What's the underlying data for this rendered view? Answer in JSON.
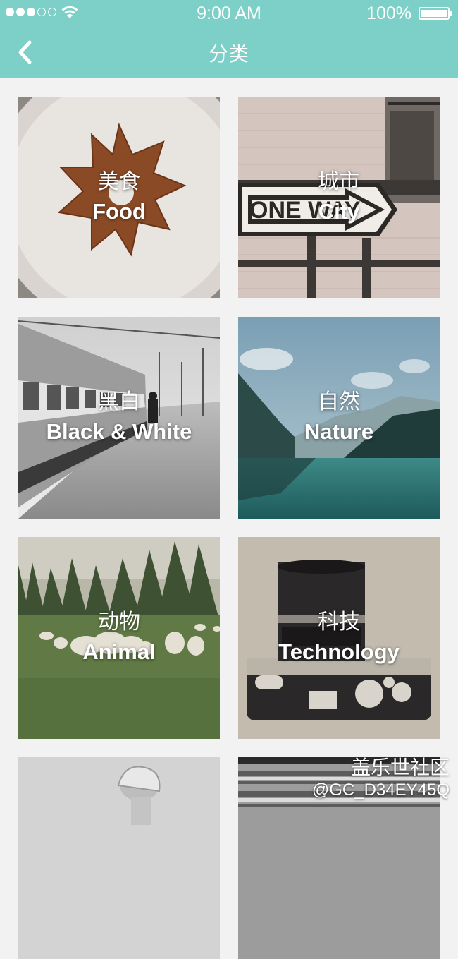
{
  "status_bar": {
    "time": "9:00 AM",
    "battery": "100%",
    "signal_bars": 3,
    "signal_total": 5
  },
  "nav": {
    "title": "分类",
    "back_icon": "chevron-left-icon"
  },
  "categories": [
    {
      "zh": "美食",
      "en": "Food"
    },
    {
      "zh": "城市",
      "en": "City",
      "sign_text": "ONE WAY"
    },
    {
      "zh": "黑白",
      "en": "Black & White"
    },
    {
      "zh": "自然",
      "en": "Nature"
    },
    {
      "zh": "动物",
      "en": "Animal"
    },
    {
      "zh": "科技",
      "en": "Technology"
    },
    {
      "zh": "",
      "en": ""
    },
    {
      "zh": "",
      "en": ""
    }
  ],
  "watermark": {
    "line1": "盖乐世社区",
    "line2": "@GC_D34EY45Q"
  },
  "colors": {
    "accent": "#7dd0c8",
    "background": "#f2f2f2"
  }
}
